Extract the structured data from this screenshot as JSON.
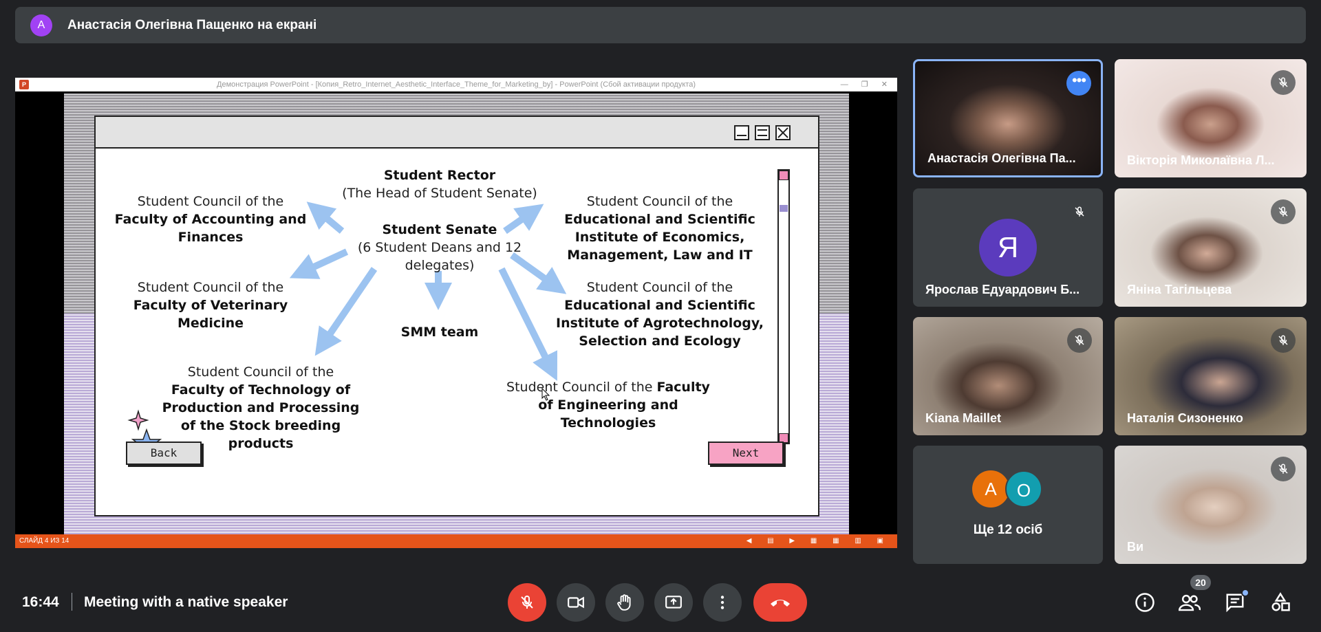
{
  "banner": {
    "avatar_letter": "А",
    "text": "Анастасія Олегівна Пащенко на екрані"
  },
  "powerpoint": {
    "logo": "P",
    "title": "Демонстрация PowerPoint - [Копия_Retro_Internet_Aesthetic_Interface_Theme_for_Marketing_by] - PowerPoint (Сбой активации продукта)",
    "window_buttons": "— ❐ ✕",
    "status_left": "СЛАЙД 4 ИЗ 14",
    "status_controls": "◀ ▤ ▶ ▦ ▦ ▥ ▣"
  },
  "slide": {
    "rector_title": "Student Rector",
    "rector_sub": "(The Head of Student Senate)",
    "senate_title": "Student Senate",
    "senate_sub": "(6 Student Deans and 12 delegates)",
    "smm": "SMM team",
    "council_prefix": "Student Council of the",
    "accounting": "Faculty of Accounting and Finances",
    "veterinary": "Faculty of Veterinary Medicine",
    "technology": "Faculty of Technology of Production and Processing of the Stock breeding products",
    "economics": "Educational and Scientific Institute of Economics, Management, Law and IT",
    "agro": "Educational and Scientific Institute of Agrotechnology, Selection and Ecology",
    "engineering": "Faculty of Engineering and Technologies",
    "back_label": "Back",
    "next_label": "Next"
  },
  "tiles": [
    {
      "name": "Анастасія Олегівна Па..."
    },
    {
      "name": "Вікторія Миколаївна Л..."
    },
    {
      "name": "Ярослав Едуардович Б...",
      "avatar_letter": "Я"
    },
    {
      "name": "Яніна Тагільцева"
    },
    {
      "name": "Kiana Maillet"
    },
    {
      "name": "Наталія Сизоненко"
    },
    {
      "name": "Ще 12 осіб",
      "avatar_a": "А",
      "avatar_o": "О"
    },
    {
      "name": "Ви"
    }
  ],
  "bottom": {
    "time": "16:44",
    "meeting": "Meeting with a native speaker",
    "participants_count": "20"
  }
}
